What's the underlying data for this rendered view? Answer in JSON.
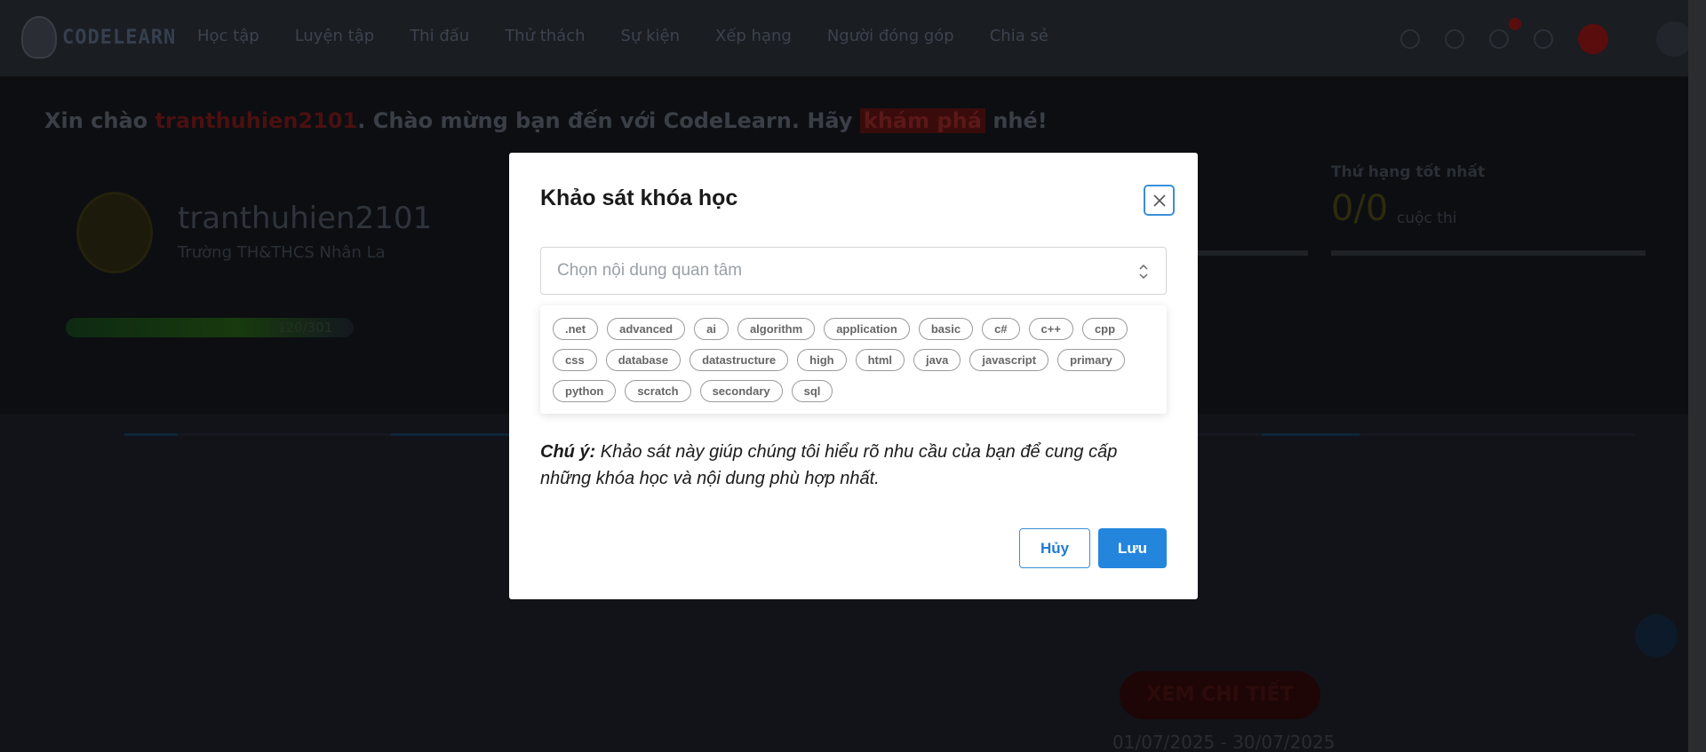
{
  "app": {
    "logo_text": "CODELEARN"
  },
  "nav": {
    "items": [
      "Học tập",
      "Luyện tập",
      "Thi đấu",
      "Thử thách",
      "Sự kiện",
      "Xếp hạng",
      "Người đóng góp",
      "Chia sẻ"
    ]
  },
  "hero": {
    "greeting_prefix": "Xin chào",
    "username_inline": "tranthuhien2101",
    "greeting_mid": ". Chào mừng bạn đến với CodeLearn. Hãy",
    "explore": "khám phá",
    "greeting_suffix": "nhé!",
    "username": "tranthuhien2101",
    "school": "Trường TH&THCS Nhân La",
    "xp": "120/301",
    "best_rank_label": "Thứ hạng tốt nhất",
    "best_rank_value": "0/0",
    "best_rank_unit": "cuộc thi"
  },
  "event": {
    "details_button": "XEM CHI TIẾT",
    "dates": "01/07/2025 - 30/07/2025"
  },
  "modal": {
    "title": "Khảo sát khóa học",
    "select_placeholder": "Chọn nội dung quan tâm",
    "tags": [
      ".net",
      "advanced",
      "ai",
      "algorithm",
      "application",
      "basic",
      "c#",
      "c++",
      "cpp",
      "css",
      "database",
      "datastructure",
      "high",
      "html",
      "java",
      "javascript",
      "primary",
      "python",
      "scratch",
      "secondary",
      "sql"
    ],
    "note_label": "Chú ý:",
    "note_text": "Khảo sát này giúp chúng tôi hiểu rõ nhu cầu của bạn để cung cấp những khóa học và nội dung phù hợp nhất.",
    "cancel_label": "Hủy",
    "save_label": "Lưu"
  },
  "colors": {
    "primary": "#2485dd",
    "overlay_bg": "#111318",
    "tag_border": "#9b9b9b"
  },
  "icons": {
    "close": "close-icon",
    "select_arrow": "chevron-up-down-icon"
  }
}
